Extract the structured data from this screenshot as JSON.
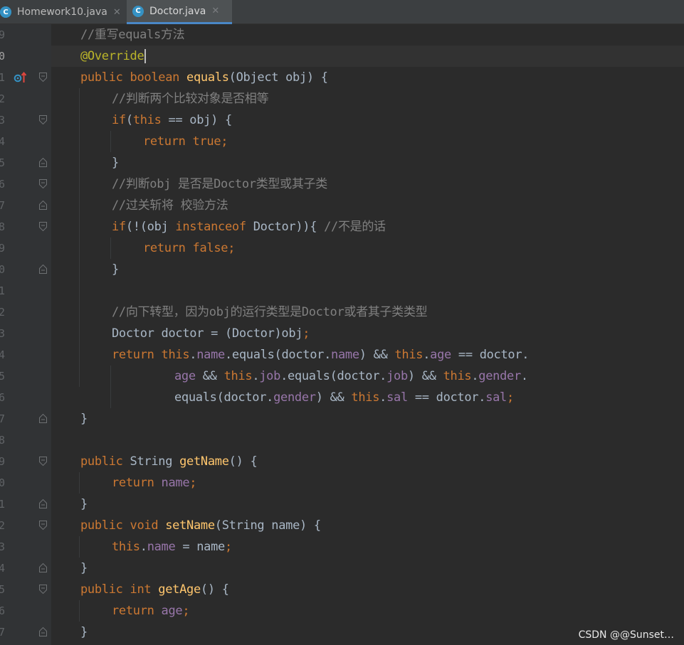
{
  "tabs": [
    {
      "label": "Homework10.java",
      "icon": "java-class-icon",
      "close": "✕"
    },
    {
      "label": "Doctor.java",
      "icon": "java-class-icon",
      "close": "✕",
      "active": true
    }
  ],
  "lines": [
    {
      "num": "9",
      "fold": "",
      "tokens": [
        [
          "cm",
          "//重写equals方法"
        ]
      ]
    },
    {
      "num": "0",
      "fold": "",
      "current": true,
      "tokens": [
        [
          "an",
          "@Override"
        ]
      ]
    },
    {
      "num": "1",
      "fold": "open",
      "override_icon": true,
      "tokens": [
        [
          "kw",
          "public "
        ],
        [
          "kw",
          "boolean "
        ],
        [
          "fn",
          "equals"
        ],
        [
          "pl",
          "(Object obj) {"
        ]
      ]
    },
    {
      "num": "2",
      "fold": "",
      "tokens": [
        [
          "cm",
          "//判断两个比较对象是否相等"
        ]
      ]
    },
    {
      "num": "3",
      "fold": "open",
      "tokens": [
        [
          "kw",
          "if"
        ],
        [
          "pl",
          "("
        ],
        [
          "kw",
          "this"
        ],
        [
          "pl",
          " == obj) {"
        ]
      ]
    },
    {
      "num": "4",
      "fold": "",
      "tokens": [
        [
          "kw",
          "return "
        ],
        [
          "kw",
          "true"
        ],
        [
          "kw",
          ";"
        ]
      ]
    },
    {
      "num": "5",
      "fold": "close",
      "tokens": [
        [
          "pl",
          "}"
        ]
      ]
    },
    {
      "num": "6",
      "fold": "open",
      "tokens": [
        [
          "cm",
          "//判断obj 是否是Doctor类型或其子类"
        ]
      ]
    },
    {
      "num": "7",
      "fold": "close",
      "tokens": [
        [
          "cm",
          "//过关斩将 校验方法"
        ]
      ]
    },
    {
      "num": "8",
      "fold": "open",
      "tokens": [
        [
          "kw",
          "if"
        ],
        [
          "pl",
          "(!(obj "
        ],
        [
          "kw",
          "instanceof "
        ],
        [
          "pl",
          "Doctor)){ "
        ],
        [
          "cm",
          "//不是的话"
        ]
      ]
    },
    {
      "num": "9",
      "fold": "",
      "tokens": [
        [
          "kw",
          "return "
        ],
        [
          "kw",
          "false"
        ],
        [
          "kw",
          ";"
        ]
      ]
    },
    {
      "num": "0",
      "fold": "close",
      "tokens": [
        [
          "pl",
          "}"
        ]
      ]
    },
    {
      "num": "1",
      "fold": "",
      "tokens": []
    },
    {
      "num": "2",
      "fold": "",
      "tokens": [
        [
          "cm",
          "//向下转型，因为obj的运行类型是Doctor或者其子类类型"
        ]
      ]
    },
    {
      "num": "3",
      "fold": "",
      "tokens": [
        [
          "pl",
          "Doctor doctor = (Doctor)obj"
        ],
        [
          "kw",
          ";"
        ]
      ]
    },
    {
      "num": "4",
      "fold": "",
      "tokens": [
        [
          "kw",
          "return "
        ],
        [
          "kw",
          "this"
        ],
        [
          "pl",
          "."
        ],
        [
          "fd",
          "name"
        ],
        [
          "pl",
          ".equals(doctor."
        ],
        [
          "fd",
          "name"
        ],
        [
          "pl",
          ") && "
        ],
        [
          "kw",
          "this"
        ],
        [
          "pl",
          "."
        ],
        [
          "fd",
          "age"
        ],
        [
          "pl",
          " == doctor."
        ]
      ]
    },
    {
      "num": "5",
      "fold": "",
      "tokens": [
        [
          "fd",
          "age"
        ],
        [
          "pl",
          " && "
        ],
        [
          "kw",
          "this"
        ],
        [
          "pl",
          "."
        ],
        [
          "fd",
          "job"
        ],
        [
          "pl",
          ".equals(doctor."
        ],
        [
          "fd",
          "job"
        ],
        [
          "pl",
          ") && "
        ],
        [
          "kw",
          "this"
        ],
        [
          "pl",
          "."
        ],
        [
          "fd",
          "gender"
        ],
        [
          "pl",
          "."
        ]
      ]
    },
    {
      "num": "6",
      "fold": "",
      "tokens": [
        [
          "pl",
          "equals(doctor."
        ],
        [
          "fd",
          "gender"
        ],
        [
          "pl",
          ") && "
        ],
        [
          "kw",
          "this"
        ],
        [
          "pl",
          "."
        ],
        [
          "fd",
          "sal"
        ],
        [
          "pl",
          " == doctor."
        ],
        [
          "fd",
          "sal"
        ],
        [
          "kw",
          ";"
        ]
      ]
    },
    {
      "num": "7",
      "fold": "close",
      "tokens": [
        [
          "pl",
          "}"
        ]
      ]
    },
    {
      "num": "8",
      "fold": "",
      "tokens": []
    },
    {
      "num": "9",
      "fold": "open",
      "tokens": [
        [
          "kw",
          "public "
        ],
        [
          "pl",
          "String "
        ],
        [
          "fn",
          "getName"
        ],
        [
          "pl",
          "() {"
        ]
      ]
    },
    {
      "num": "0",
      "fold": "",
      "tokens": [
        [
          "kw",
          "return "
        ],
        [
          "fd",
          "name"
        ],
        [
          "kw",
          ";"
        ]
      ]
    },
    {
      "num": "1",
      "fold": "close",
      "tokens": [
        [
          "pl",
          "}"
        ]
      ]
    },
    {
      "num": "2",
      "fold": "open",
      "tokens": [
        [
          "kw",
          "public "
        ],
        [
          "kw",
          "void "
        ],
        [
          "fn",
          "setName"
        ],
        [
          "pl",
          "(String name) {"
        ]
      ]
    },
    {
      "num": "3",
      "fold": "",
      "tokens": [
        [
          "kw",
          "this"
        ],
        [
          "pl",
          "."
        ],
        [
          "fd",
          "name"
        ],
        [
          "pl",
          " = name"
        ],
        [
          "kw",
          ";"
        ]
      ]
    },
    {
      "num": "4",
      "fold": "close",
      "tokens": [
        [
          "pl",
          "}"
        ]
      ]
    },
    {
      "num": "5",
      "fold": "open",
      "tokens": [
        [
          "kw",
          "public "
        ],
        [
          "kw",
          "int "
        ],
        [
          "fn",
          "getAge"
        ],
        [
          "pl",
          "() {"
        ]
      ]
    },
    {
      "num": "6",
      "fold": "",
      "tokens": [
        [
          "kw",
          "return "
        ],
        [
          "fd",
          "age"
        ],
        [
          "kw",
          ";"
        ]
      ]
    },
    {
      "num": "7",
      "fold": "close",
      "tokens": [
        [
          "pl",
          "}"
        ]
      ]
    }
  ],
  "watermark": "CSDN @@Sunset…",
  "colors": {
    "background": "#2b2b2b",
    "gutter": "#313335",
    "keyword": "#cc7832",
    "comment": "#808080",
    "annotation": "#bbb529",
    "method": "#ffc66d",
    "field": "#9876aa",
    "plain": "#a9b7c6"
  }
}
